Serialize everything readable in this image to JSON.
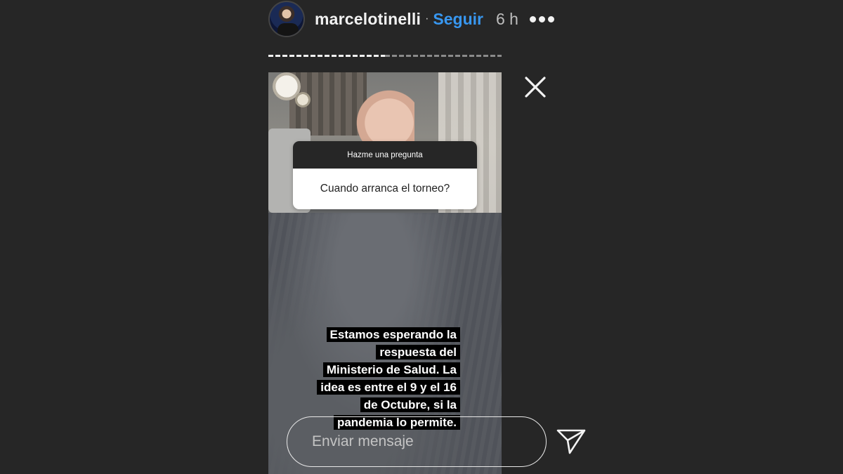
{
  "header": {
    "username": "marcelotinelli",
    "separator": "·",
    "follow_label": "Seguir",
    "time_ago": "6 h"
  },
  "story": {
    "segments_total": 2,
    "segments_done": 1,
    "question_sticker": {
      "title": "Hazme una pregunta",
      "question": "Cuando arranca el torneo?"
    },
    "caption_lines": [
      "Estamos esperando la",
      "respuesta del",
      "Ministerio de Salud. La",
      "idea es entre el 9 y el 16",
      "de Octubre, si la",
      "pandemia lo permite."
    ]
  },
  "reply": {
    "placeholder": "Enviar mensaje"
  },
  "icons": {
    "more": "more-dots-icon",
    "close": "close-icon",
    "send": "send-icon"
  },
  "colors": {
    "background": "#262626",
    "follow_link": "#3897f0"
  }
}
